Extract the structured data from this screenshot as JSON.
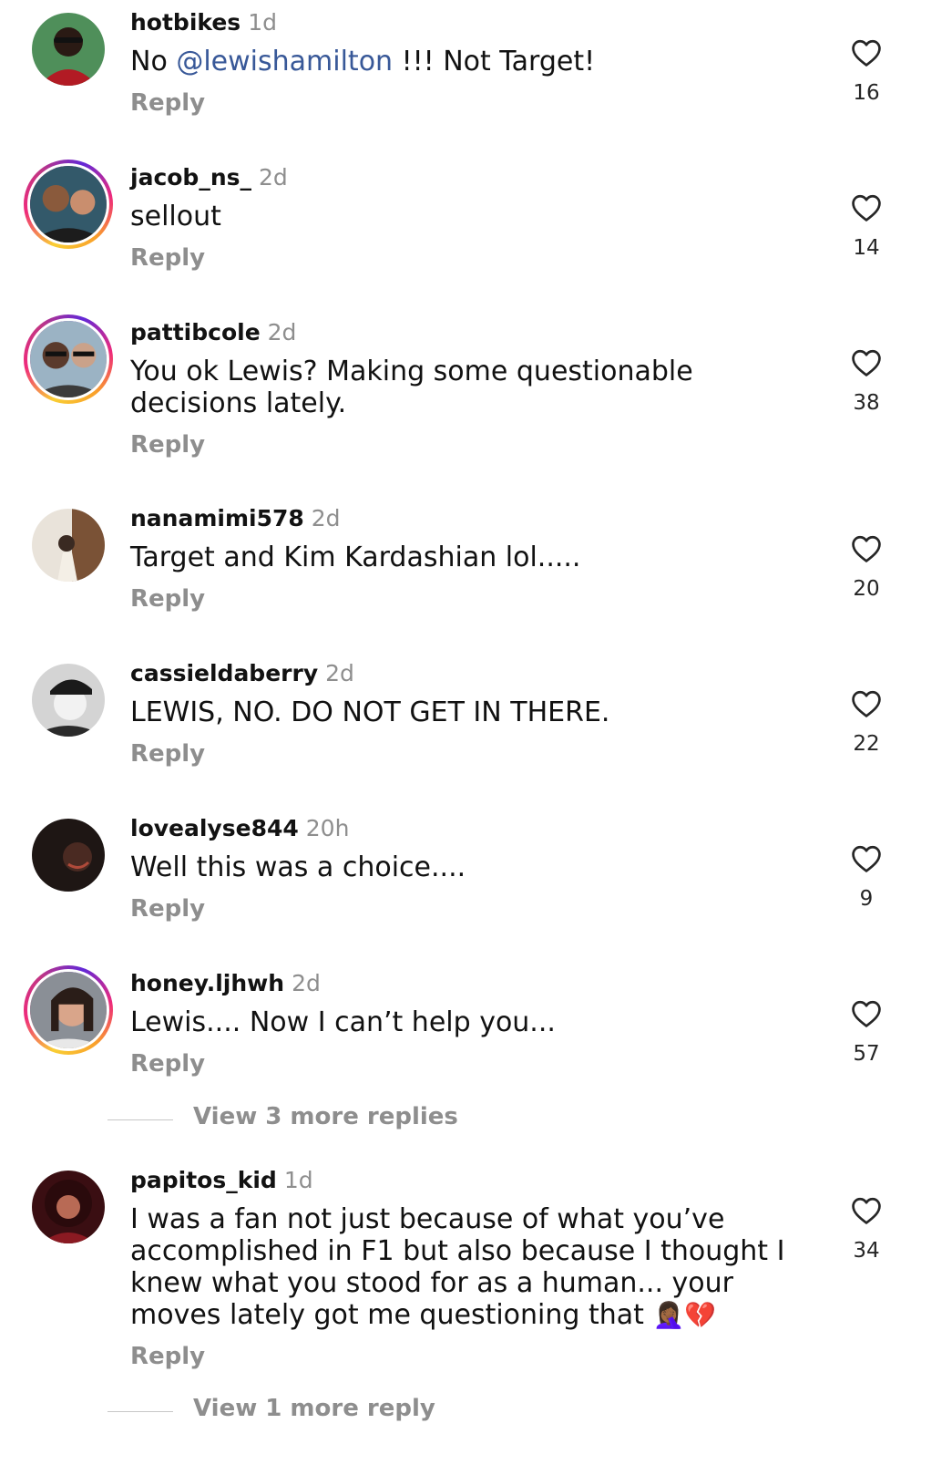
{
  "comments": [
    {
      "username": "hotbikes",
      "time": "1d",
      "text_before": "No ",
      "mention": "@lewishamilton",
      "text_after": " !!! Not Target!",
      "reply_label": "Reply",
      "likes": "16"
    },
    {
      "username": "jacob_ns_",
      "time": "2d",
      "text": "sellout",
      "reply_label": "Reply",
      "likes": "14"
    },
    {
      "username": "pattibcole",
      "time": "2d",
      "text": "You ok Lewis? Making some questionable decisions lately.",
      "reply_label": "Reply",
      "likes": "38"
    },
    {
      "username": "nanamimi578",
      "time": "2d",
      "text": "Target and Kim Kardashian lol.....",
      "reply_label": "Reply",
      "likes": "20"
    },
    {
      "username": "cassieldaberry",
      "time": "2d",
      "text": "LEWIS, NO. DO NOT GET IN THERE.",
      "reply_label": "Reply",
      "likes": "22"
    },
    {
      "username": "lovealyse844",
      "time": "20h",
      "text": "Well this was a choice....",
      "reply_label": "Reply",
      "likes": "9"
    },
    {
      "username": "honey.ljhwh",
      "time": "2d",
      "text": "Lewis.... Now I can’t help you...",
      "reply_label": "Reply",
      "likes": "57",
      "view_more": "View 3 more replies"
    },
    {
      "username": "papitos_kid",
      "time": "1d",
      "text": "I was a fan not just because of what you’ve accomplished in F1 but also because I thought I knew what you stood for as a human... your moves lately got me questioning that",
      "emojis": "🤦🏾‍♀️💔",
      "reply_label": "Reply",
      "likes": "34",
      "view_more": "View 1 more reply"
    }
  ],
  "colors": {
    "username": "#121212",
    "secondary": "#8e8e8e",
    "mention": "#385898",
    "story_ring": [
      "#f9ce34",
      "#ee2a7b",
      "#6228d7"
    ]
  },
  "icons": {
    "like": "heart-outline-icon"
  }
}
